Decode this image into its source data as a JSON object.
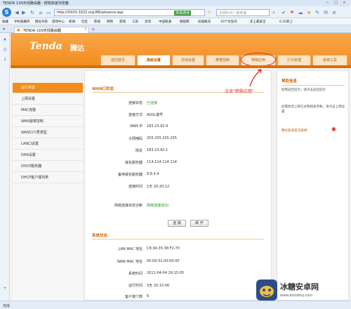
{
  "browser": {
    "title": "TENDA 11N无线路由器 - 搜狗高速浏览器",
    "url": "http://XXXX.3322.org:88/advance.asp",
    "address_badge": "高速通道",
    "search_placeholder": "全网818一番到底",
    "status": "完成",
    "favorites": [
      "收藏",
      "手机收藏夹",
      "网址导航",
      "游戏中心",
      "新闻",
      "社区",
      "影视",
      "购物",
      "游戏",
      "工具",
      "卖场",
      "中国联通",
      "搜狐网",
      "技能概况",
      "10个女生的",
      "史上最安全",
      "6.25新上"
    ],
    "tab_title": "TENDA 11N无线路由器"
  },
  "router": {
    "brand": "Tenda",
    "brand_cn": "腾达",
    "tabs": [
      "返回首页",
      "高级设置",
      "无线设置",
      "带宽控制",
      "特殊应用",
      "行为管理",
      "系统工具"
    ],
    "active_tab": 1,
    "side_menu": [
      "运行状态",
      "上网设置",
      "MAC克隆",
      "WAN速率控制",
      "WAN口介质类型",
      "LAN口设置",
      "DNS设置",
      "DHCP服务器",
      "DHCP客户端列表"
    ],
    "active_side": 0,
    "annotation": "点击\"特殊应用\"",
    "wan_section": {
      "title": "WAN口状态",
      "rows": [
        {
          "label": "连接状态",
          "value": "已连接",
          "ok": true
        },
        {
          "label": "连接方式",
          "value": "ADSL拨号"
        },
        {
          "label": "WAN IP",
          "value": "183.23.93.9"
        },
        {
          "label": "子网掩码",
          "value": "255.255.255.255"
        },
        {
          "label": "网关",
          "value": "183.23.92.1"
        },
        {
          "label": "域名服务器",
          "value": "114.114.114.114"
        },
        {
          "label": "备用域名服务器",
          "value": "8.8.4.4"
        },
        {
          "label": "连接时间",
          "value": "1天 20:20:12"
        }
      ],
      "diag_label": "网络连接状态诊断",
      "diag_value": "网络连接成功!",
      "connect_btn": "连 接",
      "disconnect_btn": "断 开"
    },
    "sys_section": {
      "title": "系统状态",
      "rows": [
        {
          "label": "LAN MAC 地址",
          "value": "C8:3A:35:38:F2:70"
        },
        {
          "label": "WAN MAC 地址",
          "value": "00:00:31:00:00:00"
        },
        {
          "label": "系统时间",
          "value": "2011-04-04 20:15:05"
        },
        {
          "label": "运行时间",
          "value": "3天 20:15:06"
        },
        {
          "label": "客户端个数",
          "value": "6"
        }
      ]
    },
    "help": {
      "title": "帮助信息",
      "p1": "如需返回首页，请点击返回首页",
      "p2": "如需修改上网方式和相关参数，请点击上网设置",
      "weibo": "腾达新浪官方微博："
    }
  },
  "watermark": {
    "text1": "冰糖安卓网",
    "text2": "www.btxtdmy.com"
  }
}
